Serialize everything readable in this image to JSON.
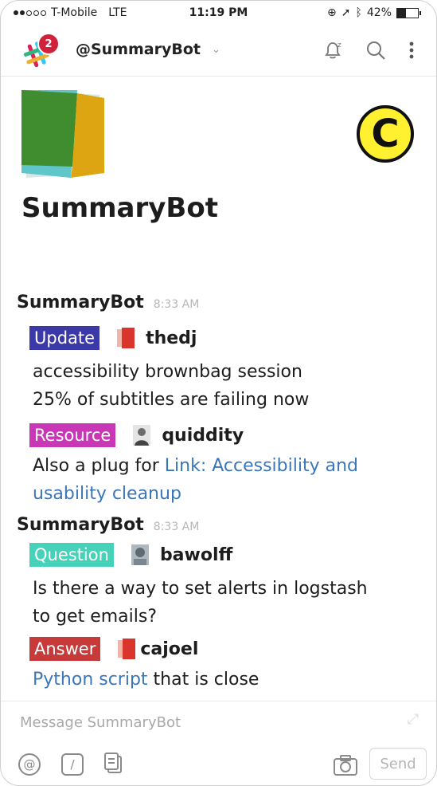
{
  "status_bar": {
    "carrier": "T-Mobile",
    "network": "LTE",
    "time": "11:19 PM",
    "battery": "42%",
    "battery_level": 0.42
  },
  "header": {
    "title": "@SummaryBot",
    "notification_count": "2",
    "icons": [
      "chevron-down-icon",
      "bell-icon",
      "search-icon",
      "more-vertical-icon"
    ]
  },
  "profile": {
    "name": "SummaryBot",
    "channel_badge": "C"
  },
  "messages": [
    {
      "sender": "SummaryBot",
      "time": "8:33 AM",
      "items": [
        {
          "tag": "Update",
          "tag_color": "#3b38a8",
          "user": "thedj",
          "avatar_color": "#d9352d",
          "lines": [
            "accessibility brownbag session",
            "25% of subtitles are failing now"
          ]
        },
        {
          "tag": "Resource",
          "tag_color": "#c737b6",
          "user": "quiddity",
          "avatar_color": "#6b6b6b",
          "text_prefix": "Also a plug for ",
          "link_text": "Link: Accessibility and usability cleanup"
        }
      ]
    },
    {
      "sender": "SummaryBot",
      "time": "8:33 AM",
      "items": [
        {
          "tag": "Question",
          "tag_color": "#46d1b9",
          "user": "bawolff",
          "avatar_color": "#5f6b72",
          "lines": [
            "Is there a way to set alerts in logstash",
            "to get emails?"
          ]
        },
        {
          "tag": "Answer",
          "tag_color": "#c63a3a",
          "user": "cajoel",
          "avatar_color": "#d9352d",
          "link_text": "Python script",
          "text_suffix": " that is close"
        }
      ]
    }
  ],
  "composer": {
    "placeholder": "Message SummaryBot",
    "send_label": "Send",
    "tools": [
      "at-icon",
      "slash-command-icon",
      "file-icon",
      "camera-icon"
    ]
  }
}
